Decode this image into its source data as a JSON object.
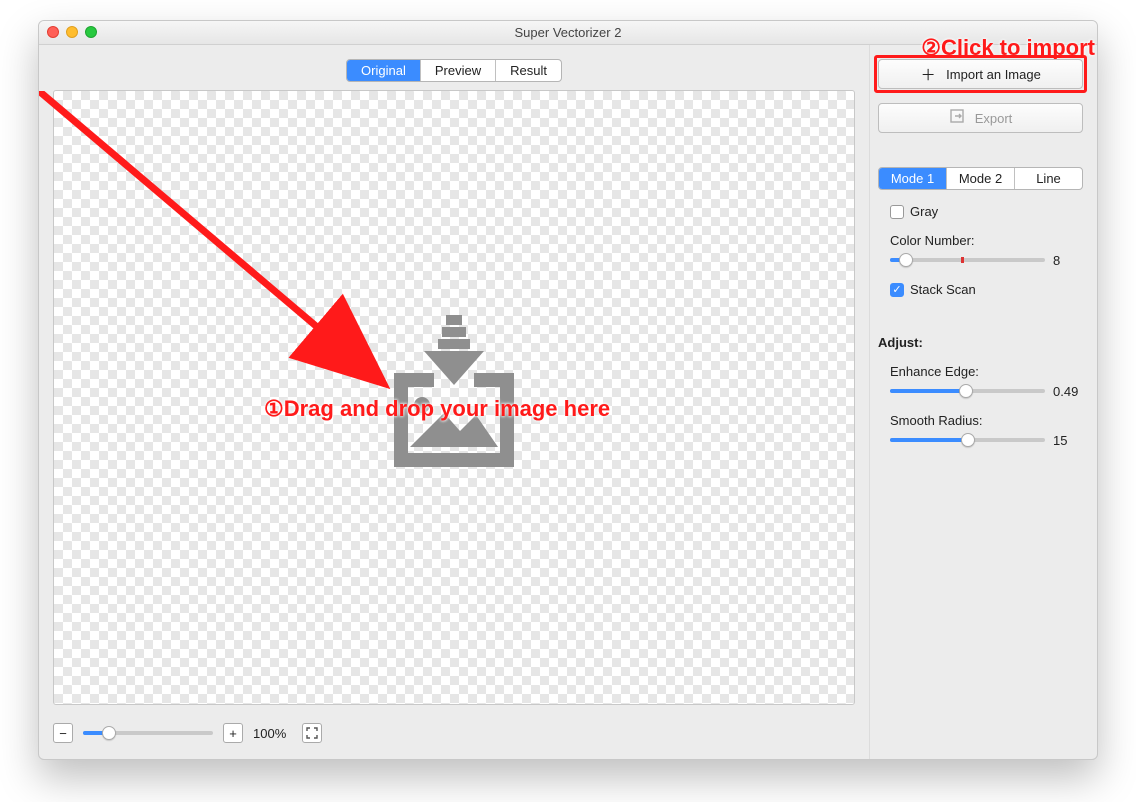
{
  "window": {
    "title": "Super Vectorizer 2"
  },
  "tabs": {
    "original": "Original",
    "preview": "Preview",
    "result": "Result",
    "active": "Original"
  },
  "annotations": {
    "drop": "①Drag and drop your image here",
    "import": "②Click to import"
  },
  "right": {
    "import": "Import an Image",
    "export": "Export",
    "modes": {
      "mode1": "Mode 1",
      "mode2": "Mode 2",
      "line": "Line",
      "active": "Mode 1"
    },
    "gray": "Gray",
    "gray_checked": false,
    "colorNumberLabel": "Color Number:",
    "colorNumberValue": "8",
    "stack": "Stack Scan",
    "stack_checked": true,
    "adjustTitle": "Adjust:",
    "enhanceLabel": "Enhance Edge:",
    "enhanceValue": "0.49",
    "smoothLabel": "Smooth Radius:",
    "smoothValue": "15"
  },
  "zoom": {
    "value": "100%"
  }
}
